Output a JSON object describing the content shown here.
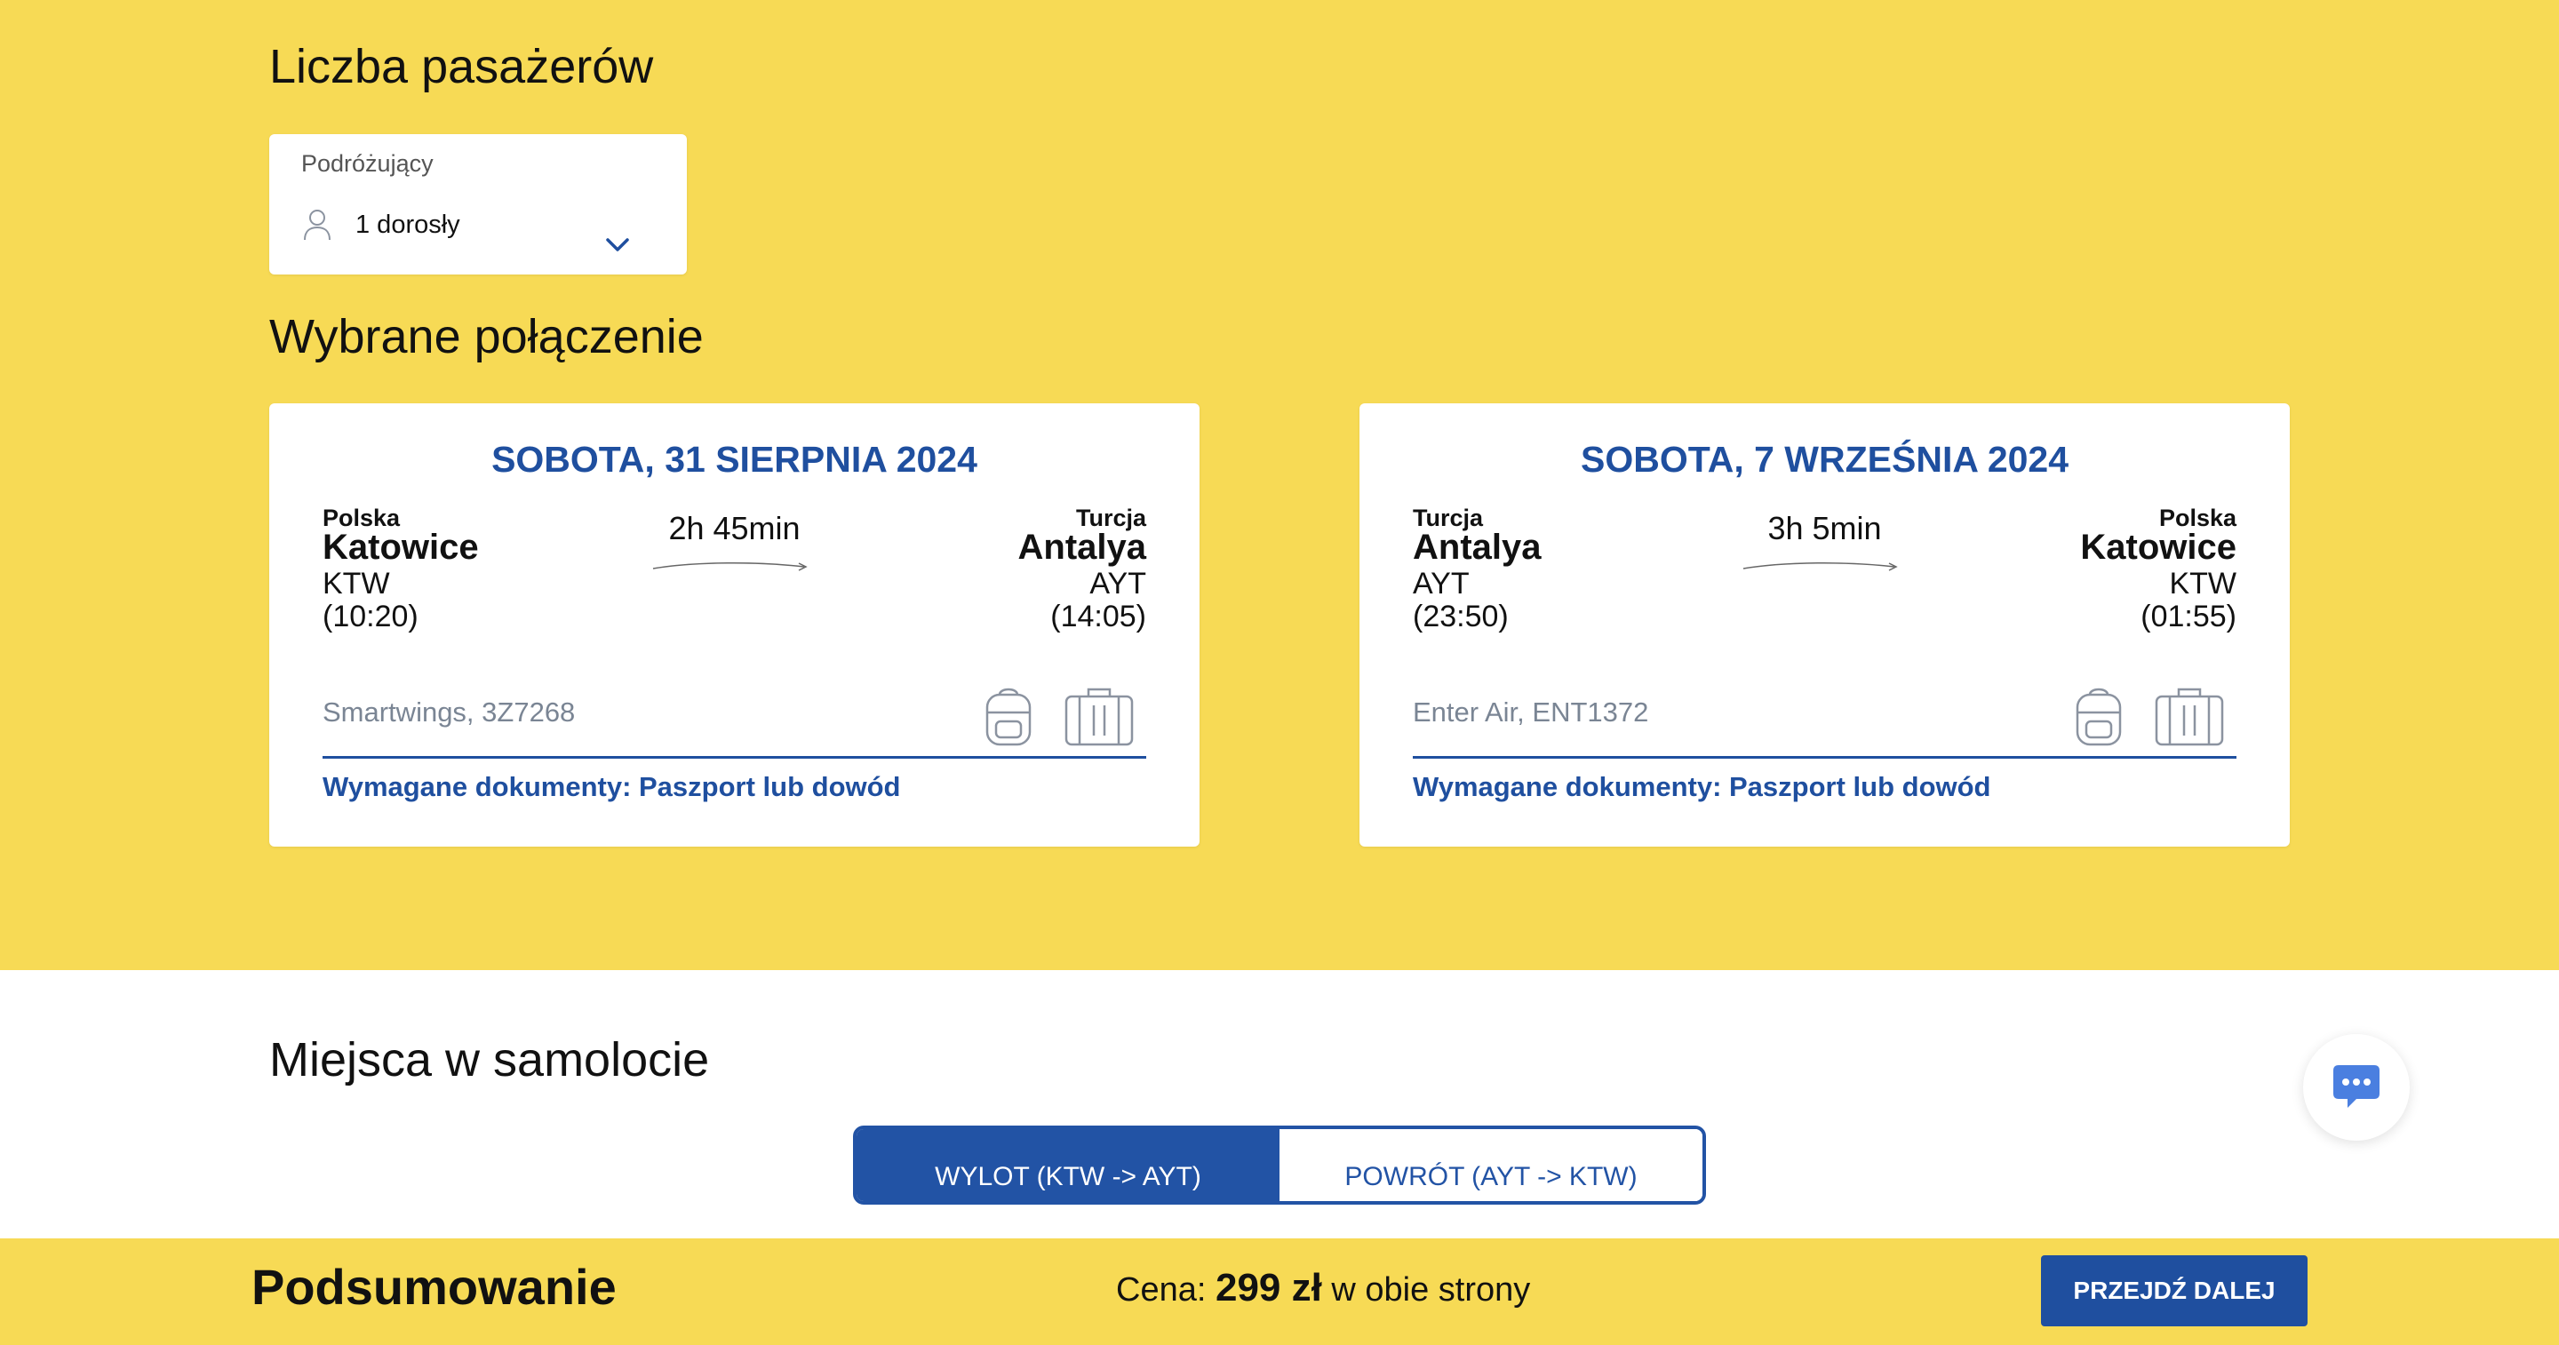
{
  "passengers": {
    "section_title": "Liczba pasażerów",
    "field_label": "Podróżujący",
    "value": "1 dorosły"
  },
  "selected_connection": {
    "section_title": "Wybrane połączenie",
    "flights": [
      {
        "date": "SOBOTA, 31 SIERPNIA 2024",
        "from": {
          "country": "Polska",
          "city": "Katowice",
          "code": "KTW",
          "time": "(10:20)"
        },
        "to": {
          "country": "Turcja",
          "city": "Antalya",
          "code": "AYT",
          "time": "(14:05)"
        },
        "duration": "2h 45min",
        "airline": "Smartwings, 3Z7268",
        "documents": "Wymagane dokumenty: Paszport lub dowód"
      },
      {
        "date": "SOBOTA, 7 WRZEŚNIA 2024",
        "from": {
          "country": "Turcja",
          "city": "Antalya",
          "code": "AYT",
          "time": "(23:50)"
        },
        "to": {
          "country": "Polska",
          "city": "Katowice",
          "code": "KTW",
          "time": "(01:55)"
        },
        "duration": "3h 5min",
        "airline": "Enter Air, ENT1372",
        "documents": "Wymagane dokumenty: Paszport lub dowód"
      }
    ]
  },
  "seats": {
    "section_title": "Miejsca w samolocie",
    "tabs": [
      {
        "label": "WYLOT (KTW -> AYT)",
        "active": true
      },
      {
        "label": "POWRÓT (AYT -> KTW)",
        "active": false
      }
    ]
  },
  "summary": {
    "title": "Podsumowanie",
    "price_prefix": "Cena:",
    "price_value": "299 zł",
    "price_suffix": "w obie strony",
    "next_button": "PRZEJDŹ DALEJ"
  },
  "icons": {
    "person": "person-icon",
    "chevron": "chevron-down-icon",
    "backpack": "backpack-icon",
    "suitcase": "suitcase-icon",
    "chat": "chat-icon"
  },
  "colors": {
    "brand_yellow": "#f7da55",
    "brand_blue": "#1f4f9f",
    "muted_text": "#7a8594"
  }
}
